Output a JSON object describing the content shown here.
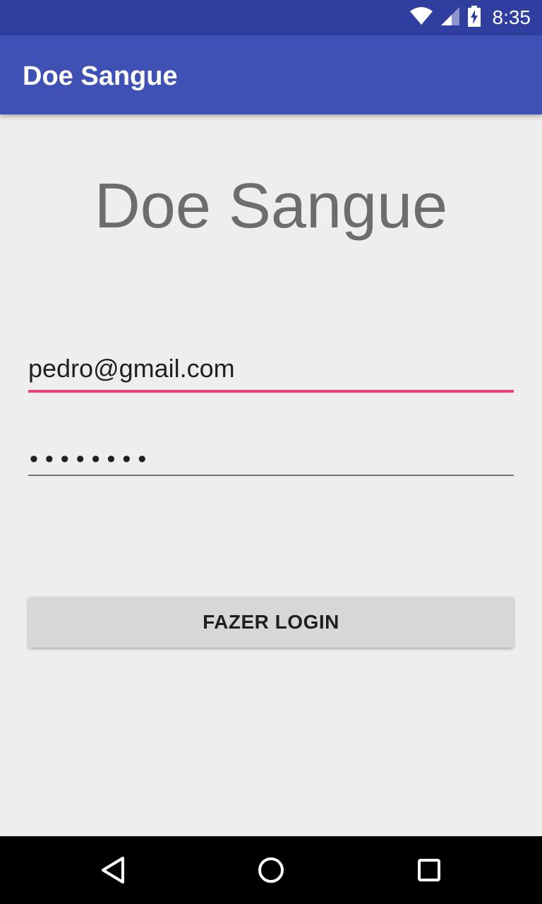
{
  "status_bar": {
    "time": "8:35",
    "icons": [
      "wifi-icon",
      "cell-signal-icon",
      "battery-charging-icon"
    ]
  },
  "app_bar": {
    "title": "Doe Sangue",
    "color": "#3f51b5",
    "status_color": "#303f9f"
  },
  "main": {
    "hero_title": "Doe Sangue",
    "email_value": "pedro@gmail.com",
    "password_mask": "••••••••",
    "login_button_label": "FAZER LOGIN",
    "accent_color": "#ec407a"
  },
  "nav_bar": {
    "buttons": [
      "back-icon",
      "home-icon",
      "recents-icon"
    ]
  }
}
